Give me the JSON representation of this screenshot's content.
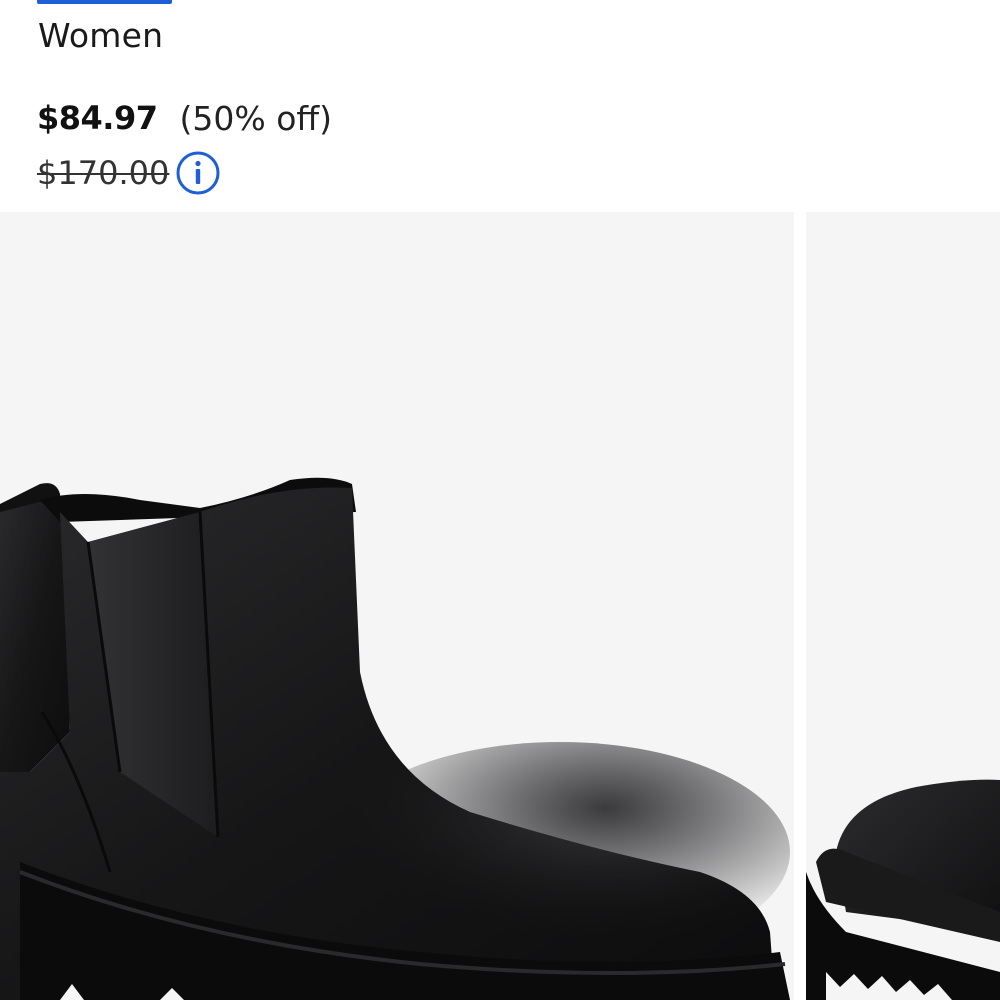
{
  "tab": {
    "active_label": "Women"
  },
  "pricing": {
    "sale_price": "$84.97",
    "discount": "(50% off)",
    "original_price": "$170.00",
    "info_icon": "info-circle-icon",
    "info_color": "#1f5fd6"
  },
  "gallery": {
    "images": [
      {
        "subject": "black leather chelsea boot, side view"
      },
      {
        "subject": "black leather chelsea boot, toe detail"
      }
    ],
    "background_color": "#f5f5f6"
  }
}
